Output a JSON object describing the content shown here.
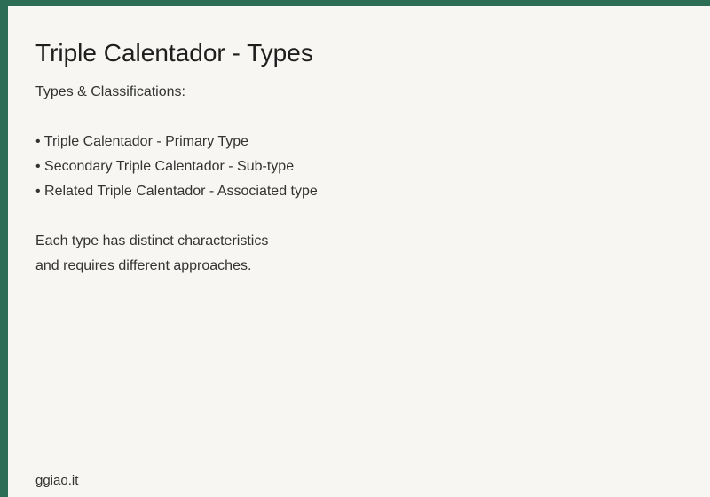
{
  "slide": {
    "title": "Triple Calentador - Types",
    "intro": "Types & Classifications:",
    "bullets": [
      "• Triple Calentador - Primary Type",
      "• Secondary Triple Calentador - Sub-type",
      "• Related Triple Calentador - Associated type"
    ],
    "summary": [
      "Each type has distinct characteristics",
      "and requires different approaches."
    ],
    "footer": "ggiao.it"
  },
  "colors": {
    "frame": "#2c6e55",
    "background": "#f7f6f2",
    "title_text": "#1e1e1e",
    "body_text": "#333333"
  }
}
